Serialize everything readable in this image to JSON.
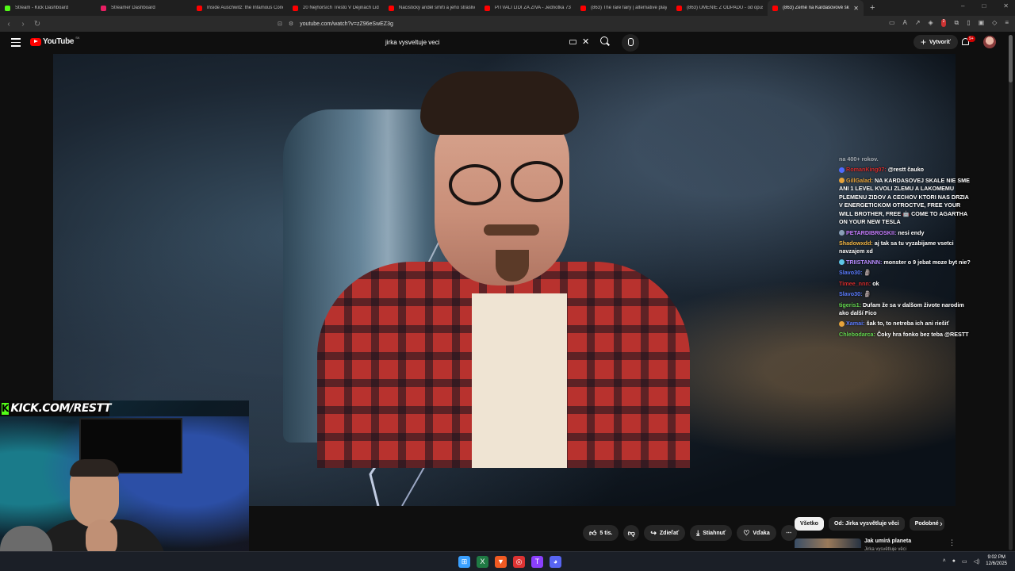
{
  "browser": {
    "tabs": [
      {
        "label": "Stream - Kick Dashboard",
        "color": "#53fc18"
      },
      {
        "label": "Streamer Dashboard",
        "color": "#e91e63"
      },
      {
        "label": "Inside Auschwitz: the Infamous Conc",
        "color": "#ff0000"
      },
      {
        "label": "20 Nejhorších Trestů V Dějinách Lids",
        "color": "#ff0000"
      },
      {
        "label": "Nacistický anděl smrti a jeho strašlivé",
        "color": "#ff0000"
      },
      {
        "label": "PITVALI LIDI ZA ŽIVA - Jednotka 731",
        "color": "#ff0000"
      },
      {
        "label": "(863) The rare fairy | alternative playli",
        "color": "#ff0000"
      },
      {
        "label": "(863) UMENIE Z ODPADU - od opusti",
        "color": "#ff0000"
      },
      {
        "label": "(863) Země na Kardašovově šk",
        "color": "#ff0000",
        "active": true
      }
    ],
    "new_tab": "+",
    "url": "youtube.com/watch?v=zZ96eSwEZ3g",
    "extension_badge": "2"
  },
  "youtube": {
    "logo_text": "YouTube",
    "region": "SK",
    "search_query": "jirka vysveltuje veci",
    "create_label": "Vytvoriť",
    "notifications": "9+"
  },
  "chat": [
    {
      "user": "",
      "user_color": "#ffffff",
      "text": "na 400+ rokov.",
      "fade": true
    },
    {
      "user": "RomanKing07:",
      "user_color": "#d22b2b",
      "text": "@restt čauko",
      "emote": "#4f6bff"
    },
    {
      "user": "GillGalad:",
      "user_color": "#e6a33b",
      "text": "NA KARDASOVEJ SKALE NIE SME ANI 1 LEVEL KVOLI ZLEMU A LAKOMEMU PLEMENU ZIDOV A CECHOV KTORI NAS DRZIA V ENERGETICKOM OTROCTVE, FREE YOUR WILL BROTHER, FREE 🤖 COME TO AGARTHA ON YOUR NEW TESLA",
      "emote": "#e6a33b"
    },
    {
      "user": "PETARDIBROSKII:",
      "user_color": "#c77dff",
      "text": "nesi endy",
      "emote": "#8aa0b8"
    },
    {
      "user": "Shadowxdd:",
      "user_color": "#f2b544",
      "text": "aj tak sa tu vyzabijame vsetci navzajem xd"
    },
    {
      "user": "TRIISTANNN:",
      "user_color": "#b78cff",
      "text": "monster o 9 jebat moze byt nie?",
      "emote": "#5ec7e8"
    },
    {
      "user": "Slavo30:",
      "user_color": "#5b7cff",
      "text": "🗿"
    },
    {
      "user": "Timee_nnn:",
      "user_color": "#d22b2b",
      "text": "ok"
    },
    {
      "user": "Slavo30:",
      "user_color": "#5b7cff",
      "text": "🗿"
    },
    {
      "user": "tigeris1:",
      "user_color": "#63d64f",
      "text": "Dufam že sa v dalšom živote narodim ako další Fico"
    },
    {
      "user": "Xamai:",
      "user_color": "#5b7cff",
      "text": "šak to, to netreba ich ani riešiť",
      "emote": "#e6a33b"
    },
    {
      "user": "Chlebodarca:",
      "user_color": "#63d64f",
      "text": "Čoky hra fonko bez teba @RESTT"
    }
  ],
  "overlay": {
    "kick_logo": "K",
    "kick_text": "KICK.COM/RESTT"
  },
  "actions": {
    "like_count": "5 tis.",
    "share_label": "Zdieľať",
    "download_label": "Stiahnuť",
    "thanks_label": "Vďaka",
    "more": "⋯"
  },
  "chips": [
    "Všetko",
    "Od: Jirka vysvětluje věci",
    "Podobné"
  ],
  "recommendation": {
    "title": "Jak umírá planeta",
    "subtitle": "Jirka vysvětluje věci"
  },
  "taskbar": {
    "time": "9:02 PM",
    "date": "12/6/2025"
  }
}
